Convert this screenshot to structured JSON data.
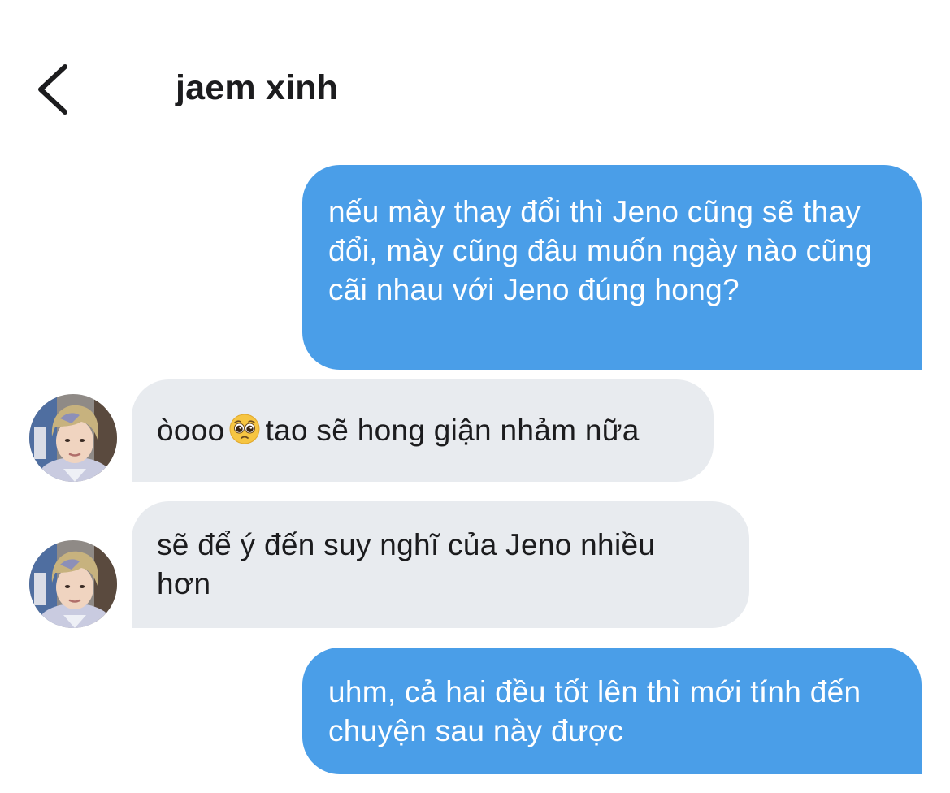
{
  "header": {
    "title": "jaem xinh",
    "back_icon": "chevron-left-icon"
  },
  "colors": {
    "sent_bubble": "#4a9ee8",
    "received_bubble": "#e8ebef",
    "sent_text": "#ffffff",
    "received_text": "#1c1c1e"
  },
  "messages": [
    {
      "direction": "sent",
      "text": "nếu mày thay đổi thì Jeno cũng sẽ thay đổi, mày cũng đâu muốn ngày nào cũng cãi nhau với Jeno đúng hong?"
    },
    {
      "direction": "received",
      "text_before_emoji": "òooo",
      "emoji": "pleading-face-emoji",
      "text_after_emoji": "tao sẽ hong giận nhảm nữa",
      "avatar": "contact-avatar"
    },
    {
      "direction": "received",
      "text": "sẽ để ý đến suy nghĩ của Jeno nhiều hơn",
      "avatar": "contact-avatar"
    },
    {
      "direction": "sent",
      "text": "uhm, cả hai đều tốt lên thì mới tính đến chuyện sau này được"
    }
  ]
}
